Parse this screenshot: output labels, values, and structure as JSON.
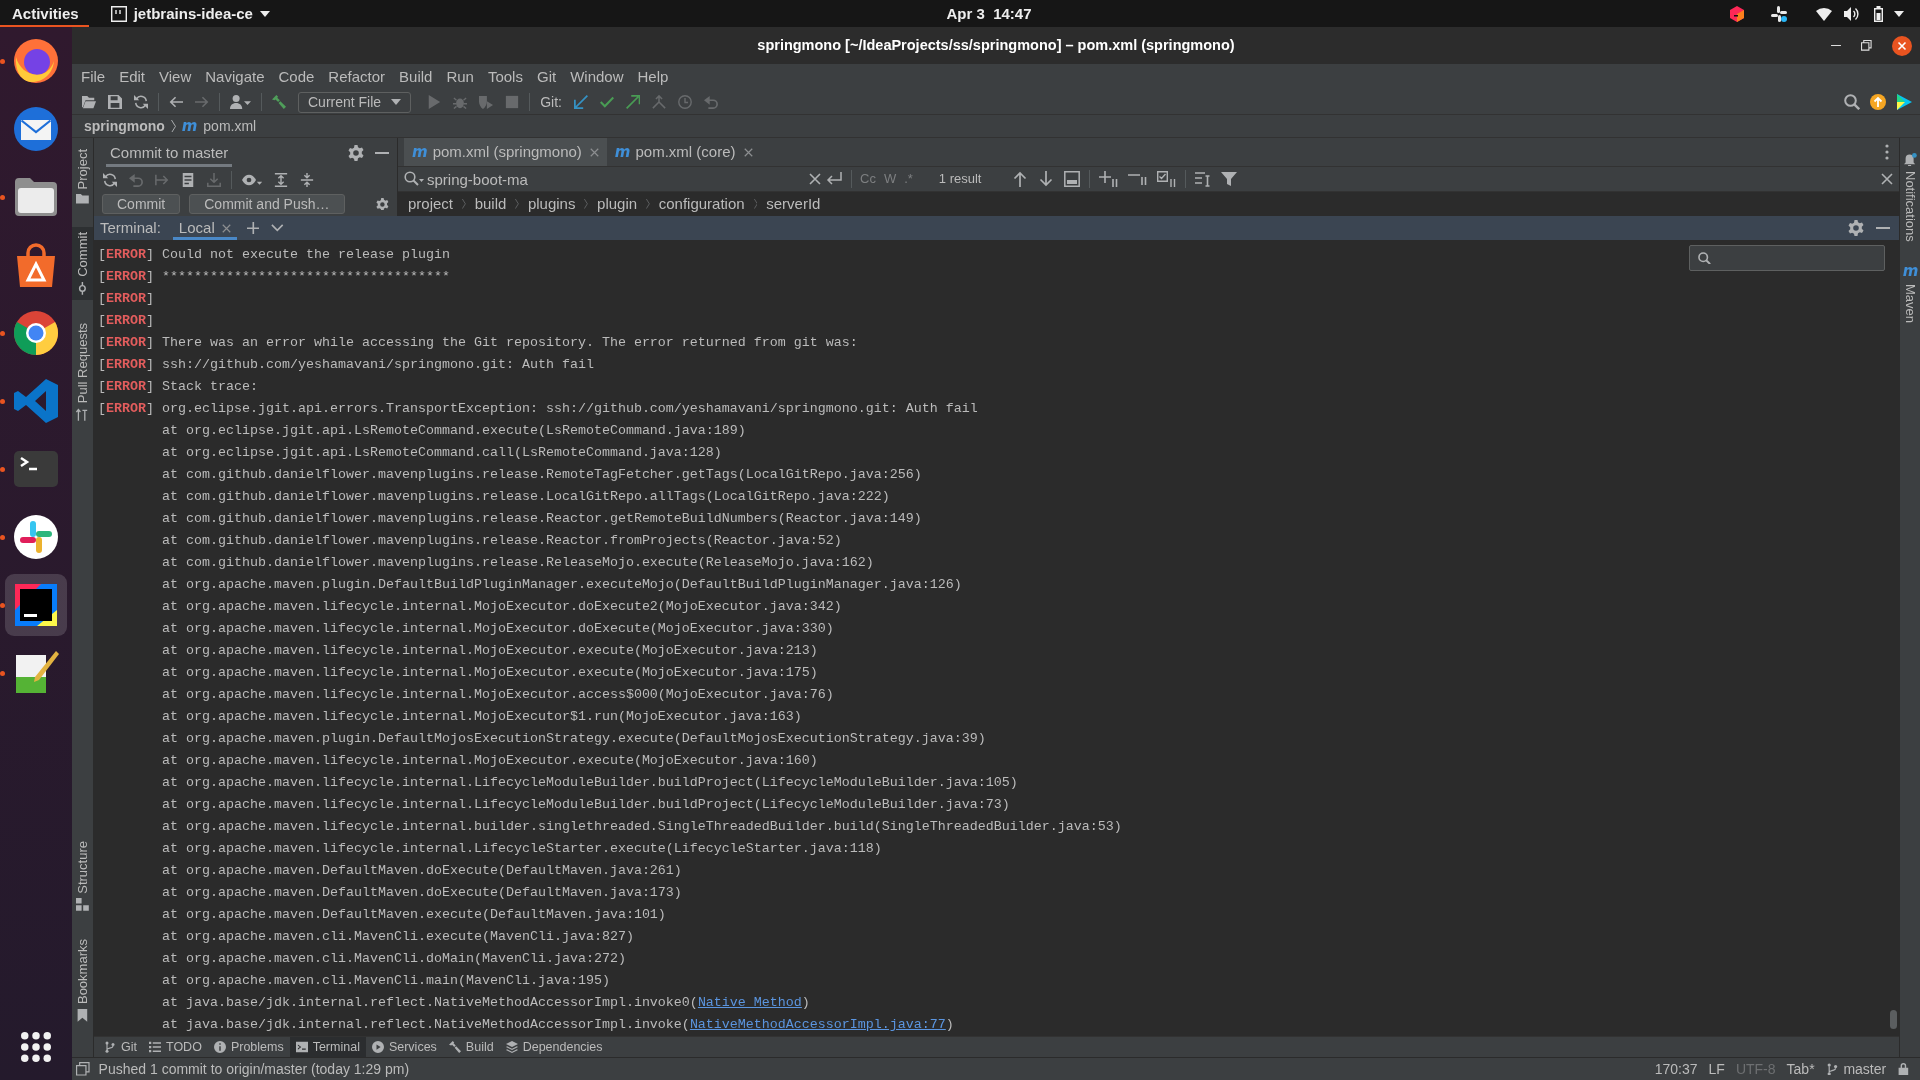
{
  "top_bar": {
    "activities": "Activities",
    "app_menu": "jetbrains-idea-ce",
    "clock": "Apr 3  14:47"
  },
  "dock": {
    "items": [
      {
        "kind": "fox-browser",
        "running": true,
        "selected": false
      },
      {
        "kind": "mail",
        "running": false,
        "selected": false
      },
      {
        "kind": "files",
        "running": true,
        "selected": false
      },
      {
        "kind": "store",
        "running": false,
        "selected": false
      },
      {
        "kind": "browser",
        "running": true,
        "selected": false
      },
      {
        "kind": "code-editor",
        "running": true,
        "selected": false
      },
      {
        "kind": "terminal",
        "running": true,
        "selected": false
      },
      {
        "kind": "chat",
        "running": true,
        "selected": false
      },
      {
        "kind": "ide",
        "running": true,
        "selected": true
      },
      {
        "kind": "notepad",
        "running": true,
        "selected": false
      }
    ]
  },
  "window": {
    "title": "springmono [~/IdeaProjects/ss/springmono] – pom.xml (springmono)"
  },
  "menu": [
    "File",
    "Edit",
    "View",
    "Navigate",
    "Code",
    "Refactor",
    "Build",
    "Run",
    "Tools",
    "Git",
    "Window",
    "Help"
  ],
  "toolbar": {
    "groups": [
      [
        {
          "kind": "open",
          "disabled": false
        },
        {
          "kind": "save",
          "disabled": false
        },
        {
          "kind": "sync",
          "disabled": false
        }
      ],
      [
        {
          "kind": "back",
          "disabled": false
        },
        {
          "kind": "forward",
          "disabled": true
        }
      ],
      [
        {
          "kind": "user",
          "disabled": false
        }
      ],
      [
        {
          "kind": "build",
          "disabled": false
        },
        {
          "kind": "dropdown",
          "label": "Current File",
          "disabled": false
        },
        {
          "kind": "run",
          "disabled": true
        },
        {
          "kind": "debug",
          "disabled": true
        },
        {
          "kind": "coverage",
          "disabled": true
        },
        {
          "kind": "stop",
          "disabled": true
        }
      ],
      [
        {
          "kind": "label",
          "label": "Git:",
          "disabled": false
        },
        {
          "kind": "update",
          "disabled": false
        },
        {
          "kind": "commit",
          "disabled": false
        },
        {
          "kind": "push",
          "disabled": false
        },
        {
          "kind": "merge",
          "disabled": true
        },
        {
          "kind": "history",
          "disabled": true
        },
        {
          "kind": "rollback",
          "disabled": true
        }
      ]
    ]
  },
  "nav_bar": {
    "project": "springmono",
    "file_icon": "m",
    "file": "pom.xml"
  },
  "left_stripe": {
    "top": [
      {
        "kind": "project",
        "label": "Project",
        "selected": false
      },
      {
        "kind": "commit",
        "label": "Commit",
        "selected": true
      },
      {
        "kind": "pull-requests",
        "label": "Pull Requests",
        "selected": false
      }
    ],
    "bottom": [
      {
        "kind": "structure",
        "label": "Structure",
        "selected": false
      },
      {
        "kind": "bookmarks",
        "label": "Bookmarks",
        "selected": false
      }
    ]
  },
  "right_stripe": [
    {
      "kind": "notifications",
      "label": "Notifications",
      "selected": false
    },
    {
      "kind": "maven",
      "icon": "m",
      "label": "Maven",
      "selected": false
    }
  ],
  "commit_panel": {
    "tabs": [
      {
        "label": "Commit to master",
        "selected": true
      }
    ],
    "toolbar": [
      [
        {
          "kind": "refresh",
          "disabled": false
        },
        {
          "kind": "rollback",
          "disabled": true
        },
        {
          "kind": "move",
          "disabled": true
        },
        {
          "kind": "diff",
          "disabled": false
        },
        {
          "kind": "download",
          "disabled": true
        }
      ],
      [
        {
          "kind": "view-options",
          "disabled": false
        },
        {
          "kind": "expand-all",
          "disabled": false
        },
        {
          "kind": "collapse-all",
          "disabled": false
        }
      ]
    ],
    "buttons": [
      "Commit",
      "Commit and Push…"
    ]
  },
  "editor": {
    "tabs": [
      {
        "icon": "m",
        "label": "pom.xml (springmono)",
        "selected": true
      },
      {
        "icon": "m",
        "label": "pom.xml (core)",
        "selected": false
      }
    ],
    "search": {
      "value": "spring-boot-ma",
      "options": [
        {
          "label": "Cc",
          "selected": false
        },
        {
          "label": "W",
          "selected": false
        },
        {
          "label": ".*",
          "selected": false
        }
      ],
      "result": "1 result"
    },
    "breadcrumbs": [
      "project",
      "build",
      "plugins",
      "plugin",
      "configuration",
      "serverId"
    ]
  },
  "terminal": {
    "title": "Terminal:",
    "tabs": [
      {
        "label": "Local",
        "selected": true
      }
    ],
    "lines": [
      {
        "kind": "error",
        "prefix": "[**ERROR**]",
        "text": "Could not execute the release plugin"
      },
      {
        "kind": "error",
        "prefix": "[**ERROR**]",
        "text": "************************************"
      },
      {
        "kind": "error",
        "prefix": "[**ERROR**]"
      },
      {
        "kind": "error",
        "prefix": "[**ERROR**]"
      },
      {
        "kind": "error",
        "prefix": "[**ERROR**]",
        "text": "There was an error while accessing the Git repository. The error returned from git was:"
      },
      {
        "kind": "error",
        "prefix": "[**ERROR**]",
        "text": "ssh://github.com/yeshamavani/springmono.git: Auth fail"
      },
      {
        "kind": "error",
        "prefix": "[**ERROR**]",
        "text": "Stack trace:"
      },
      {
        "kind": "error",
        "prefix": "[**ERROR**]",
        "text": "org.eclipse.jgit.api.errors.TransportException: ssh://github.com/yeshamavani/springmono.git: Auth fail"
      },
      {
        "kind": "trace",
        "text": "at org.eclipse.jgit.api.LsRemoteCommand.execute(LsRemoteCommand.java:189)"
      },
      {
        "kind": "trace",
        "text": "at org.eclipse.jgit.api.LsRemoteCommand.call(LsRemoteCommand.java:128)"
      },
      {
        "kind": "trace",
        "text": "at com.github.danielflower.mavenplugins.release.RemoteTagFetcher.getTags(LocalGitRepo.java:256)"
      },
      {
        "kind": "trace",
        "text": "at com.github.danielflower.mavenplugins.release.LocalGitRepo.allTags(LocalGitRepo.java:222)"
      },
      {
        "kind": "trace",
        "text": "at com.github.danielflower.mavenplugins.release.Reactor.getRemoteBuildNumbers(Reactor.java:149)"
      },
      {
        "kind": "trace",
        "text": "at com.github.danielflower.mavenplugins.release.Reactor.fromProjects(Reactor.java:52)"
      },
      {
        "kind": "trace",
        "text": "at com.github.danielflower.mavenplugins.release.ReleaseMojo.execute(ReleaseMojo.java:162)"
      },
      {
        "kind": "trace",
        "text": "at org.apache.maven.plugin.DefaultBuildPluginManager.executeMojo(DefaultBuildPluginManager.java:126)"
      },
      {
        "kind": "trace",
        "text": "at org.apache.maven.lifecycle.internal.MojoExecutor.doExecute2(MojoExecutor.java:342)"
      },
      {
        "kind": "trace",
        "text": "at org.apache.maven.lifecycle.internal.MojoExecutor.doExecute(MojoExecutor.java:330)"
      },
      {
        "kind": "trace",
        "text": "at org.apache.maven.lifecycle.internal.MojoExecutor.execute(MojoExecutor.java:213)"
      },
      {
        "kind": "trace",
        "text": "at org.apache.maven.lifecycle.internal.MojoExecutor.execute(MojoExecutor.java:175)"
      },
      {
        "kind": "trace",
        "text": "at org.apache.maven.lifecycle.internal.MojoExecutor.access$000(MojoExecutor.java:76)"
      },
      {
        "kind": "trace",
        "text": "at org.apache.maven.lifecycle.internal.MojoExecutor$1.run(MojoExecutor.java:163)"
      },
      {
        "kind": "trace",
        "text": "at org.apache.maven.plugin.DefaultMojosExecutionStrategy.execute(DefaultMojosExecutionStrategy.java:39)"
      },
      {
        "kind": "trace",
        "text": "at org.apache.maven.lifecycle.internal.MojoExecutor.execute(MojoExecutor.java:160)"
      },
      {
        "kind": "trace",
        "text": "at org.apache.maven.lifecycle.internal.LifecycleModuleBuilder.buildProject(LifecycleModuleBuilder.java:105)"
      },
      {
        "kind": "trace",
        "text": "at org.apache.maven.lifecycle.internal.LifecycleModuleBuilder.buildProject(LifecycleModuleBuilder.java:73)"
      },
      {
        "kind": "trace",
        "text": "at org.apache.maven.lifecycle.internal.builder.singlethreaded.SingleThreadedBuilder.build(SingleThreadedBuilder.java:53)"
      },
      {
        "kind": "trace",
        "text": "at org.apache.maven.lifecycle.internal.LifecycleStarter.execute(LifecycleStarter.java:118)"
      },
      {
        "kind": "trace",
        "text": "at org.apache.maven.DefaultMaven.doExecute(DefaultMaven.java:261)"
      },
      {
        "kind": "trace",
        "text": "at org.apache.maven.DefaultMaven.doExecute(DefaultMaven.java:173)"
      },
      {
        "kind": "trace",
        "text": "at org.apache.maven.DefaultMaven.execute(DefaultMaven.java:101)"
      },
      {
        "kind": "trace",
        "text": "at org.apache.maven.cli.MavenCli.execute(MavenCli.java:827)"
      },
      {
        "kind": "trace",
        "text": "at org.apache.maven.cli.MavenCli.doMain(MavenCli.java:272)"
      },
      {
        "kind": "trace",
        "text": "at org.apache.maven.cli.MavenCli.main(MavenCli.java:195)"
      },
      {
        "kind": "trace",
        "text": "at java.base/jdk.internal.reflect.NativeMethodAccessorImpl.invoke0(",
        "link": "Native Method",
        "text_after": ")"
      },
      {
        "kind": "trace",
        "text": "at java.base/jdk.internal.reflect.NativeMethodAccessorImpl.invoke(",
        "link": "NativeMethodAccessorImpl.java:77",
        "text_after": ")"
      }
    ]
  },
  "bottom_tabs": [
    {
      "kind": "git",
      "label": "Git",
      "selected": false
    },
    {
      "kind": "todo",
      "label": "TODO",
      "selected": false
    },
    {
      "kind": "problems",
      "label": "Problems",
      "selected": false
    },
    {
      "kind": "terminal",
      "label": "Terminal",
      "selected": true
    },
    {
      "kind": "services",
      "label": "Services",
      "selected": false
    },
    {
      "kind": "build",
      "label": "Build",
      "selected": false
    },
    {
      "kind": "dependencies",
      "label": "Dependencies",
      "selected": false
    }
  ],
  "status_bar": {
    "message": "Pushed 1 commit to origin/master (today 1:29 pm)",
    "items": [
      {
        "kind": "text",
        "label": "170:37",
        "disabled": false
      },
      {
        "kind": "text",
        "label": "LF",
        "disabled": false
      },
      {
        "kind": "text",
        "label": "UTF-8",
        "disabled": true
      },
      {
        "kind": "text",
        "label": "Tab*",
        "disabled": false
      },
      {
        "kind": "branch",
        "label": "master",
        "disabled": false
      }
    ]
  }
}
